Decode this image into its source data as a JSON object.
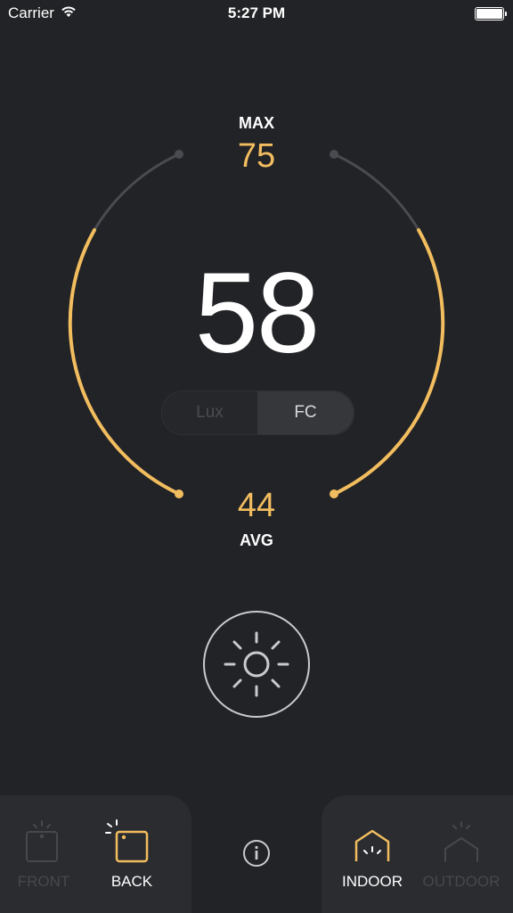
{
  "status_bar": {
    "carrier": "Carrier",
    "time": "5:27 PM"
  },
  "meter": {
    "max_label": "MAX",
    "max_value": "75",
    "reading": "58",
    "avg_value": "44",
    "avg_label": "AVG"
  },
  "units": {
    "options": [
      "Lux",
      "FC"
    ],
    "selected": "FC"
  },
  "sensor_tabs": {
    "front": "FRONT",
    "back": "BACK",
    "selected": "BACK"
  },
  "mode_tabs": {
    "indoor": "INDOOR",
    "outdoor": "OUTDOOR",
    "selected": "INDOOR"
  },
  "colors": {
    "accent": "#f2bd5f",
    "background": "#222326",
    "panel": "#2b2c30",
    "inactive": "#47484c"
  },
  "icons": {
    "wifi": "wifi-icon",
    "battery": "battery-icon",
    "measure": "sun-icon",
    "info": "info-icon",
    "front": "phone-front-icon",
    "back": "phone-back-icon",
    "indoor": "house-indoor-icon",
    "outdoor": "house-outdoor-icon"
  }
}
